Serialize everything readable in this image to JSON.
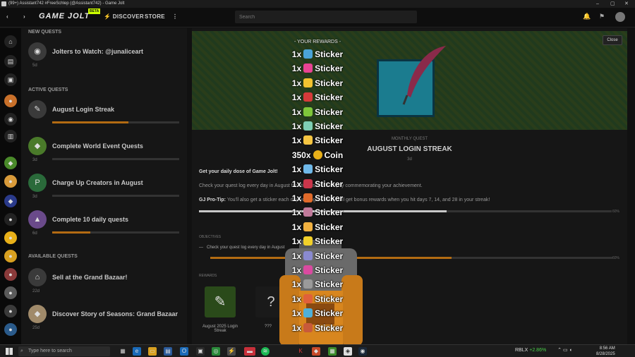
{
  "window": {
    "title": "(99+) Assistant742 #FreeSchlep (@Assistant742) - Game Jolt"
  },
  "nav": {
    "brand": "GAME JOLT",
    "beta": "BETA",
    "discover": "DISCOVER",
    "store": "STORE",
    "search_placeholder": "Search"
  },
  "panel": {
    "new_heading": "NEW QUESTS",
    "active_heading": "ACTIVE QUESTS",
    "available_heading": "AVAILABLE QUESTS",
    "new": [
      {
        "title": "Jolters to Watch: @junaliceart",
        "meta": "5d"
      }
    ],
    "active": [
      {
        "title": "August Login Streak",
        "progress": 0.6,
        "meta": ""
      },
      {
        "title": "Complete World Event Quests",
        "progress": 0.0,
        "meta": "3d"
      },
      {
        "title": "Charge Up Creators in August",
        "progress": 0.0,
        "meta": "3d"
      },
      {
        "title": "Complete 10 daily quests",
        "progress": 0.3,
        "meta": "6d"
      }
    ],
    "available": [
      {
        "title": "Sell at the Grand Bazaar!",
        "meta": "22d"
      },
      {
        "title": "Discover Story of Seasons: Grand Bazaar",
        "meta": "25d"
      }
    ]
  },
  "quest": {
    "close": "Close",
    "subtitle": "MONTHLY QUEST",
    "name": "AUGUST LOGIN STREAK",
    "time": "3d",
    "tagline": "Get your daily dose of Game Jolt!",
    "desc": "Check your quest log every day in August for stickers and a trophy commemorating your achievement.",
    "protip_label": "GJ Pro-Tip:",
    "protip": "You'll also get a sticker each day you log in, and you'll get bonus rewards when you hit days 7, 14, and 28 in your streak!",
    "progress_pct": "60%",
    "objectives_head": "OBJECTIVES",
    "objective": "Check your quest log every day in August",
    "objective_pct": "60%",
    "rewards_head": "REWARDS",
    "reward_items": [
      {
        "label": "August 2025 Login Streak"
      },
      {
        "label": "???"
      }
    ]
  },
  "rewards_overlay": {
    "header": "- YOUR REWARDS -",
    "rows": [
      {
        "qty": "1x",
        "name": "Sticker",
        "color": "#4aa3d8"
      },
      {
        "qty": "1x",
        "name": "Sticker",
        "color": "#e84393"
      },
      {
        "qty": "1x",
        "name": "Sticker",
        "color": "#f2c230"
      },
      {
        "qty": "1x",
        "name": "Sticker",
        "color": "#d63a3a"
      },
      {
        "qty": "1x",
        "name": "Sticker",
        "color": "#7fc63a"
      },
      {
        "qty": "1x",
        "name": "Sticker",
        "color": "#7ecfb3"
      },
      {
        "qty": "1x",
        "name": "Sticker",
        "color": "#f5c542"
      },
      {
        "qty": "350x",
        "name": "Coin",
        "color": "#e8b019"
      },
      {
        "qty": "1x",
        "name": "Sticker",
        "color": "#6fb8e8"
      },
      {
        "qty": "1x",
        "name": "Sticker",
        "color": "#c9354a"
      },
      {
        "qty": "1x",
        "name": "Sticker",
        "color": "#e06a2a"
      },
      {
        "qty": "1x",
        "name": "Sticker",
        "color": "#c07a9a"
      },
      {
        "qty": "1x",
        "name": "Sticker",
        "color": "#f0b040"
      },
      {
        "qty": "1x",
        "name": "Sticker",
        "color": "#f2d02a"
      },
      {
        "qty": "1x",
        "name": "Sticker",
        "color": "#8a8ad0"
      },
      {
        "qty": "1x",
        "name": "Sticker",
        "color": "#d94aa0"
      },
      {
        "qty": "1x",
        "name": "Sticker",
        "color": "#9a9a9a"
      },
      {
        "qty": "1x",
        "name": "Sticker",
        "color": "#e0603a"
      },
      {
        "qty": "1x",
        "name": "Sticker",
        "color": "#4fb0d8"
      },
      {
        "qty": "1x",
        "name": "Sticker",
        "color": "#c85a3a"
      }
    ]
  },
  "taskbar": {
    "search": "Type here to search",
    "stock_name": "RBLX",
    "stock_change": "+2.86%",
    "time": "8:56 AM",
    "date": "8/28/2025"
  }
}
